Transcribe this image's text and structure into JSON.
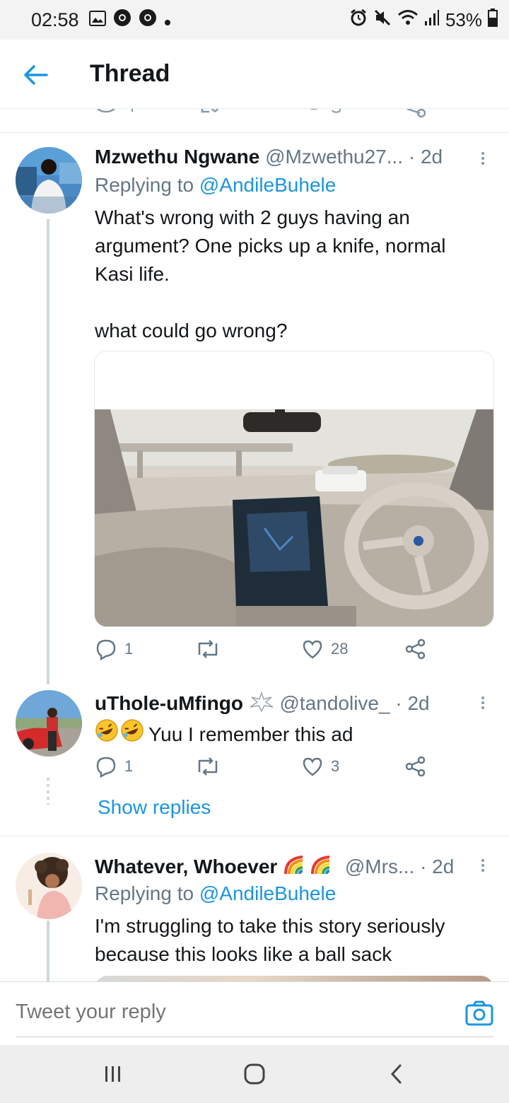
{
  "status_bar": {
    "time": "02:58",
    "battery": "53%"
  },
  "header": {
    "title": "Thread"
  },
  "tweets": [
    {
      "name": "Mzwethu Ngwane",
      "handle": "@Mzwethu27...",
      "time": "· 2d",
      "replying_prefix": "Replying to",
      "replying_to": "@AndileBuhele",
      "text_lines": [
        "What's wrong with 2 guys having an",
        "argument? One picks up a knife, normal",
        "Kasi life."
      ],
      "text_extra": "what could go wrong?",
      "replies": "1",
      "retweets": "",
      "likes": "28"
    },
    {
      "name": "uThole-uMfingo",
      "handle": "@tandolive_",
      "time": "· 2d",
      "text": "Yuu I remember this ad",
      "replies": "1",
      "retweets": "",
      "likes": "3",
      "show_replies": "Show replies"
    },
    {
      "name": "Whatever, Whoever",
      "handle": "@Mrs...",
      "time": "· 2d",
      "replying_prefix": "Replying to",
      "replying_to": "@AndileBuhele",
      "text_lines": [
        "I'm struggling to take this story seriously",
        "because this looks like a ball sack"
      ]
    }
  ],
  "reply_box": {
    "placeholder": "Tweet your reply"
  },
  "colors": {
    "accent": "#1b95e0",
    "secondary_text": "#657786",
    "primary_text": "#14171a"
  }
}
